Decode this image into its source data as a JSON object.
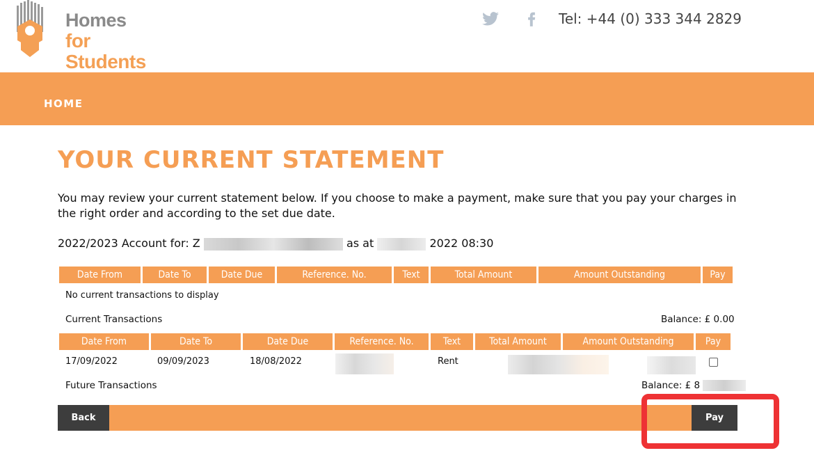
{
  "header": {
    "logo_line1": "Homes",
    "logo_line2": "for Students",
    "tel": "Tel: +44 (0) 333 344 2829"
  },
  "nav": {
    "home": "HOME"
  },
  "main": {
    "title": "YOUR CURRENT STATEMENT",
    "intro": "You may review your current statement below. If you choose to make a payment, make sure that you pay your charges in the right order and according to the set due date.",
    "account_prefix": "2022/2023 Account for: Z",
    "account_mid": "as at",
    "account_time": "2022 08:30"
  },
  "table1": {
    "headers": [
      "Date From",
      "Date To",
      "Date Due",
      "Reference. No.",
      "Text",
      "Total Amount",
      "Amount Outstanding",
      "Pay"
    ],
    "empty_message": "No current transactions to display",
    "section_label": "Current Transactions",
    "balance": "Balance: £ 0.00"
  },
  "table2": {
    "headers": [
      "Date From",
      "Date To",
      "Date Due",
      "Reference. No.",
      "Text",
      "Total Amount",
      "Amount Outstanding",
      "Pay"
    ],
    "rows": [
      {
        "date_from": "17/09/2022",
        "date_to": "09/09/2023",
        "date_due": "18/08/2022",
        "text": "Rent"
      }
    ],
    "section_label": "Future Transactions",
    "balance_prefix": "Balance: £ 8"
  },
  "buttons": {
    "back": "Back",
    "pay": "Pay"
  },
  "colors": {
    "accent": "#f59e54",
    "dark_button": "#3d3d3d",
    "highlight": "#ee3234"
  }
}
